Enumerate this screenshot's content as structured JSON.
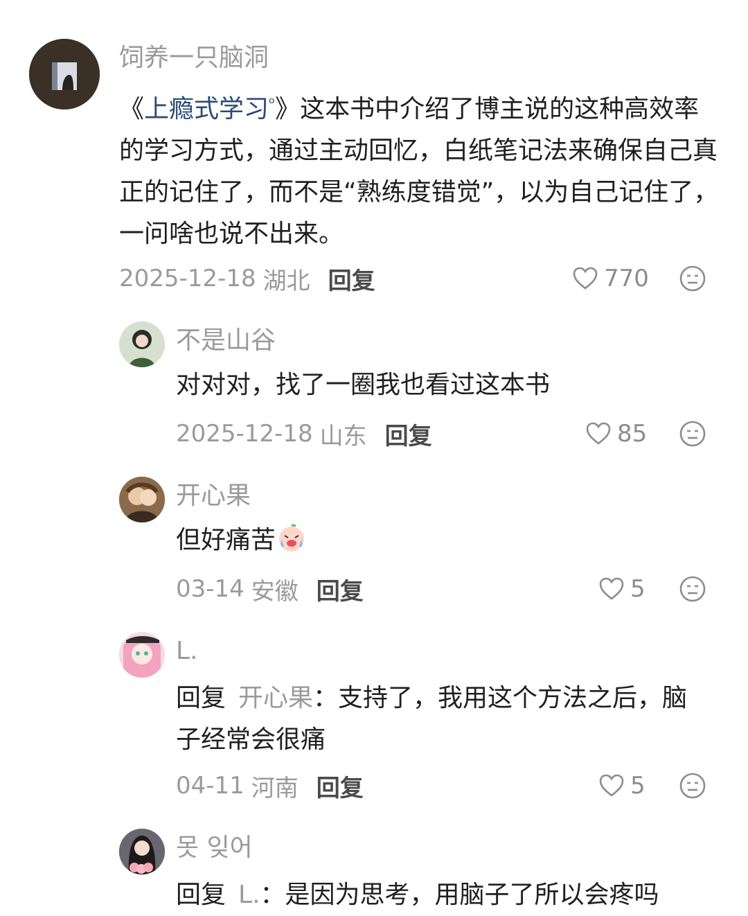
{
  "comments": [
    {
      "username": "饲养一只脑洞",
      "text_prefix": "《",
      "book_link": "上瘾式学习",
      "text_after_link": "》这本书中介绍了博主说的这种高效率的学习方式，通过主动回忆，白纸笔记法来确保自己真正的记住了，而不是“熟练度错觉”，以为自己记住了，一问啥也说不出来。",
      "date": "2025-12-18",
      "location": "湖北",
      "reply_label": "回复",
      "likes": "770"
    },
    {
      "username": "不是山谷",
      "text": "对对对，找了一圈我也看过这本书",
      "date": "2025-12-18",
      "location": "山东",
      "reply_label": "回复",
      "likes": "85"
    },
    {
      "username": "开心果",
      "text": "但好痛苦",
      "date": "03-14",
      "location": "安徽",
      "reply_label": "回复",
      "likes": "5"
    },
    {
      "username": "L.",
      "reply_prefix": "回复",
      "reply_to": "开心果",
      "text": "：支持了，我用这个方法之后，脑子经常会很痛",
      "date": "04-11",
      "location": "河南",
      "reply_label": "回复",
      "likes": "5"
    },
    {
      "username": "못 잊어",
      "reply_prefix": "回复",
      "reply_to": "L.",
      "text": "：是因为思考，用脑子了所以会疼吗"
    }
  ],
  "icons": {
    "like": "heart-outline-icon",
    "more": "neutral-face-icon",
    "emoji": "crying-face-emoji"
  }
}
